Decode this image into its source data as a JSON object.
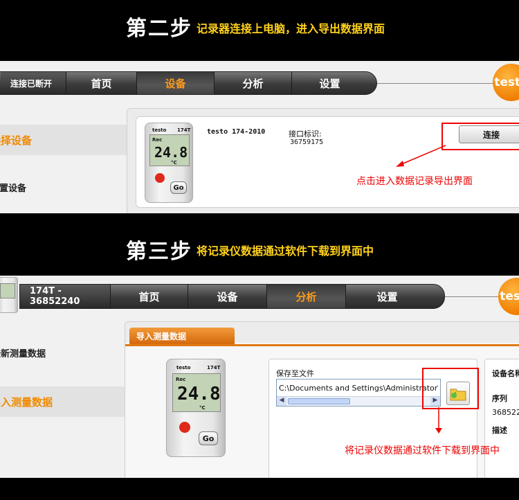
{
  "step2": {
    "title": "第二步",
    "desc": "记录器连接上电脑，进入导出数据界面",
    "status_label": "连接已断开",
    "tabs": [
      "首页",
      "设备",
      "分析",
      "设置"
    ],
    "active_tab": "设备",
    "logo_text": "testo",
    "menu": [
      "选择设备",
      "配置设备"
    ],
    "device_model": "testo 174-2010",
    "interface_label": "接口标识:",
    "interface_id": "36759175",
    "connect_button": "连接",
    "annotation": "点击进入数据记录导出界面",
    "device_brand": "testo",
    "device_type": "174T",
    "device_rec": "Rec",
    "device_reading": "24.8",
    "device_unit": "°C",
    "go_label": "Go"
  },
  "step3": {
    "title": "第三步",
    "desc": "将记录仪数据通过软件下载到界面中",
    "device_label": "174T - 36852240",
    "tabs": [
      "首页",
      "设备",
      "分析",
      "设置"
    ],
    "active_tab": "分析",
    "logo_text": "testo",
    "menu": [
      "最新测量数据",
      "导入测量数据"
    ],
    "panel_tab": "导入测量数据",
    "save_to_file_label": "保存至文件",
    "file_path": "C:\\Documents and Settings\\Administrator\\桌面",
    "right_header": "设备名称",
    "serial_label": "序列",
    "serial_value": "368522",
    "desc_label": "描述",
    "annotation": "将记录仪数据通过软件下载到界面中",
    "device_brand": "testo",
    "device_type": "174T",
    "device_rec": "Rec",
    "device_reading": "24.8",
    "device_unit": "°C",
    "go_label": "Go"
  }
}
